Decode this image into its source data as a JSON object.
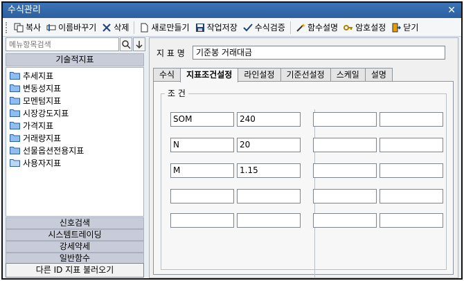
{
  "window": {
    "title": "수식관리",
    "close_glyph": "✕"
  },
  "toolbar": {
    "items": [
      {
        "label": "복사",
        "icon": "copy-icon"
      },
      {
        "label": "이름바꾸기",
        "icon": "rename-icon"
      },
      {
        "label": "삭제",
        "icon": "delete-icon"
      },
      {
        "label": "새로만들기",
        "icon": "new-doc-icon"
      },
      {
        "label": "작업저장",
        "icon": "save-icon"
      },
      {
        "label": "수식검증",
        "icon": "check-icon"
      },
      {
        "label": "함수설명",
        "icon": "magic-wand-icon"
      },
      {
        "label": "암호설정",
        "icon": "key-icon"
      },
      {
        "label": "닫기",
        "icon": "exit-icon"
      }
    ]
  },
  "sidebar": {
    "search_placeholder": "메뉴항목검색",
    "category_header": "기술적지표",
    "items": [
      "추세지표",
      "변동성지표",
      "모멘텀지표",
      "시장강도지표",
      "가격지표",
      "거래량지표",
      "선물옵션전용지표",
      "사용자지표"
    ],
    "bottom_categories": [
      "신호검색",
      "시스템트레이딩",
      "강세약세",
      "일반함수"
    ],
    "load_button": "다른 ID 지표 불러오기"
  },
  "main": {
    "name_label": "지 표 명",
    "name_value": "기준봉 거래대금",
    "tabs": [
      "수식",
      "지표조건설정",
      "라인설정",
      "기준선설정",
      "스케일",
      "설명"
    ],
    "active_tab_index": 1,
    "condition_group_label": "조 건",
    "conditions_left": [
      {
        "name": "SOM",
        "value": "240"
      },
      {
        "name": "N",
        "value": "20"
      },
      {
        "name": "M",
        "value": "1.15"
      },
      {
        "name": "",
        "value": ""
      },
      {
        "name": "",
        "value": ""
      }
    ],
    "conditions_right": [
      {
        "name": "",
        "value": ""
      },
      {
        "name": "",
        "value": ""
      },
      {
        "name": "",
        "value": ""
      },
      {
        "name": "",
        "value": ""
      },
      {
        "name": "",
        "value": ""
      }
    ]
  }
}
